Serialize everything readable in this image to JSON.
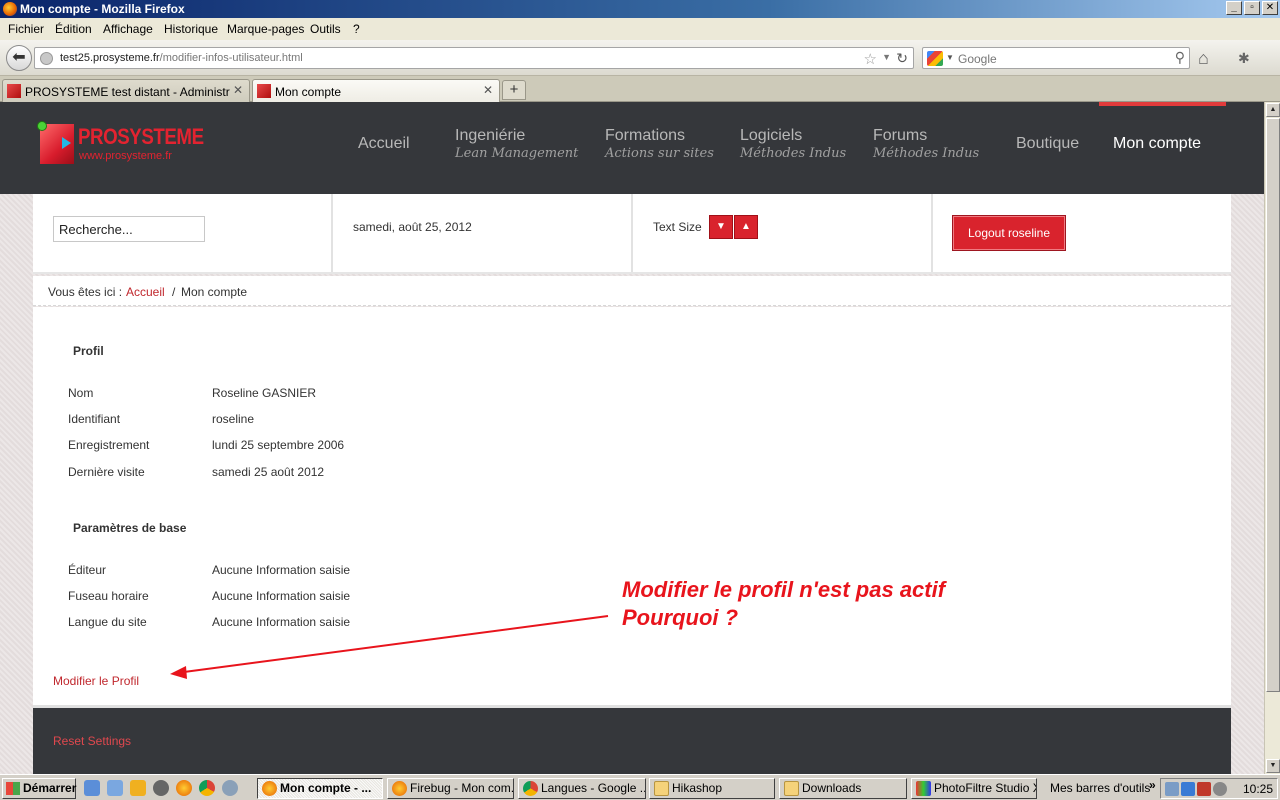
{
  "window": {
    "title": "Mon compte - Mozilla Firefox"
  },
  "menu": [
    "Fichier",
    "Édition",
    "Affichage",
    "Historique",
    "Marque-pages",
    "Outils",
    "?"
  ],
  "address": {
    "host": "test25.prosysteme.fr",
    "path": "/modifier-infos-utilisateur.html"
  },
  "search_engine": {
    "placeholder": "Google"
  },
  "tabs": [
    {
      "label": "PROSYSTEME test distant - Administration",
      "active": false
    },
    {
      "label": "Mon compte",
      "active": true
    }
  ],
  "site": {
    "logo": {
      "name": "PROSYSTEME",
      "url": "www.prosysteme.fr"
    },
    "nav": [
      {
        "label": "Accueil",
        "sub": ""
      },
      {
        "label": "Ingeniérie",
        "sub": "Lean Management"
      },
      {
        "label": "Formations",
        "sub": "Actions sur sites"
      },
      {
        "label": "Logiciels",
        "sub": "Méthodes Indus"
      },
      {
        "label": "Forums",
        "sub": "Méthodes Indus"
      },
      {
        "label": "Boutique",
        "sub": ""
      },
      {
        "label": "Mon compte",
        "sub": "",
        "active": true
      }
    ],
    "search_value": "Recherche...",
    "date": "samedi, août 25, 2012",
    "text_size_label": "Text Size",
    "logout_label": "Logout roseline",
    "breadcrumb": {
      "lead": "Vous êtes ici :",
      "home": "Accueil",
      "sep": "/",
      "current": "Mon compte"
    },
    "profile": {
      "title": "Profil",
      "rows": [
        {
          "label": "Nom",
          "value": "Roseline GASNIER"
        },
        {
          "label": "Identifiant",
          "value": "roseline"
        },
        {
          "label": "Enregistrement",
          "value": "lundi 25 septembre 2006"
        },
        {
          "label": "Dernière visite",
          "value": "samedi 25 août 2012"
        }
      ]
    },
    "base_params": {
      "title": "Paramètres de base",
      "rows": [
        {
          "label": "Éditeur",
          "value": "Aucune Information saisie"
        },
        {
          "label": "Fuseau horaire",
          "value": "Aucune Information saisie"
        },
        {
          "label": "Langue du site",
          "value": "Aucune Information saisie"
        }
      ]
    },
    "edit_profile_label": "Modifier le Profil",
    "reset_label": "Reset Settings"
  },
  "annotation": {
    "line1": "Modifier le profil n'est pas actif",
    "line2": "Pourquoi ?",
    "color": "#e8141c"
  },
  "taskbar": {
    "start_label": "Démarrer",
    "tasks": [
      {
        "label": "Mon compte - ...",
        "active": true
      },
      {
        "label": "Firebug - Mon com..."
      },
      {
        "label": "Langues - Google ..."
      },
      {
        "label": "Hikashop"
      },
      {
        "label": "Downloads"
      },
      {
        "label": "PhotoFiltre Studio X"
      }
    ],
    "toolbars_label": "Mes barres d'outils",
    "clock": "10:25"
  },
  "colors": {
    "accent": "#d9232d",
    "header_bg": "#35373b",
    "link": "#c0272d"
  }
}
